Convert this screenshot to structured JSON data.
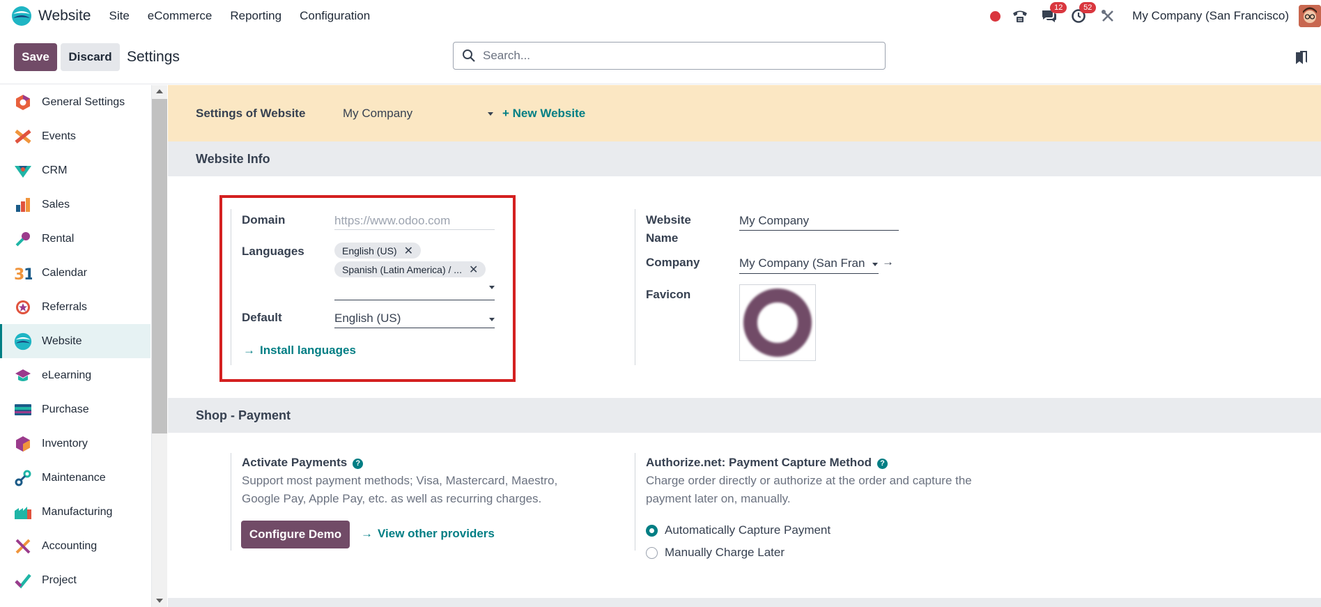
{
  "navbar": {
    "app_name": "Website",
    "menu": [
      "Site",
      "eCommerce",
      "Reporting",
      "Configuration"
    ],
    "chat_badge": "12",
    "activity_badge": "52",
    "company": "My Company (San Francisco)"
  },
  "control": {
    "save": "Save",
    "discard": "Discard",
    "title": "Settings",
    "search_placeholder": "Search..."
  },
  "sidebar": {
    "items": [
      {
        "label": "General Settings",
        "icon": "general-settings-icon"
      },
      {
        "label": "Events",
        "icon": "events-icon"
      },
      {
        "label": "CRM",
        "icon": "crm-icon"
      },
      {
        "label": "Sales",
        "icon": "sales-icon"
      },
      {
        "label": "Rental",
        "icon": "rental-icon"
      },
      {
        "label": "Calendar",
        "icon": "calendar-icon"
      },
      {
        "label": "Referrals",
        "icon": "referrals-icon"
      },
      {
        "label": "Website",
        "icon": "website-icon",
        "active": true
      },
      {
        "label": "eLearning",
        "icon": "elearning-icon"
      },
      {
        "label": "Purchase",
        "icon": "purchase-icon"
      },
      {
        "label": "Inventory",
        "icon": "inventory-icon"
      },
      {
        "label": "Maintenance",
        "icon": "maintenance-icon"
      },
      {
        "label": "Manufacturing",
        "icon": "manufacturing-icon"
      },
      {
        "label": "Accounting",
        "icon": "accounting-icon"
      },
      {
        "label": "Project",
        "icon": "project-icon"
      }
    ]
  },
  "website_bar": {
    "label": "Settings of Website",
    "selected": "My Company",
    "new_website": "+ New Website"
  },
  "website_info": {
    "heading": "Website Info",
    "domain_label": "Domain",
    "domain_placeholder": "https://www.odoo.com",
    "languages_label": "Languages",
    "languages": [
      "English (US)",
      "Spanish (Latin America) / ..."
    ],
    "default_label": "Default",
    "default_value": "English (US)",
    "install_languages": "Install languages",
    "website_name_label_1": "Website",
    "website_name_label_2": "Name",
    "website_name_value": "My Company",
    "company_label": "Company",
    "company_value": "My Company (San Franc",
    "favicon_label": "Favicon"
  },
  "shop_payment": {
    "heading": "Shop - Payment",
    "activate_title": "Activate Payments",
    "activate_desc_1": "Support most payment methods; Visa, Mastercard, Maestro,",
    "activate_desc_2": "Google Pay, Apple Pay, etc. as well as recurring charges.",
    "configure_demo": "Configure Demo",
    "view_providers": "View other providers",
    "capture_title": "Authorize.net: Payment Capture Method",
    "capture_desc_1": "Charge order directly or authorize at the order and capture the",
    "capture_desc_2": "payment later on, manually.",
    "options": [
      "Automatically Capture Payment",
      "Manually Charge Later"
    ],
    "selected_option": 0
  },
  "colors": {
    "brand": "#714b67",
    "accent": "#017e84",
    "website_bar_bg": "#fbe7c3",
    "section_bg": "#e9ebee",
    "highlight": "#d42020",
    "badge": "#d9363e"
  }
}
